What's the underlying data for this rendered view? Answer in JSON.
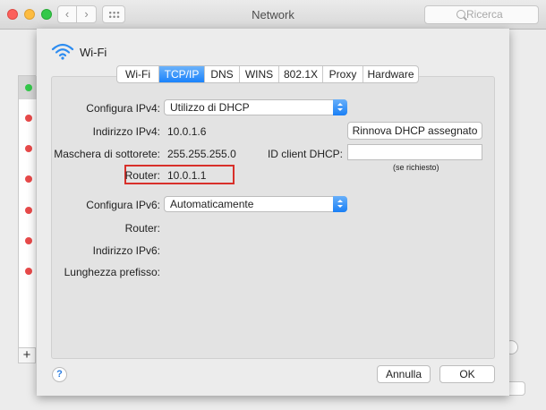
{
  "window": {
    "title": "Network"
  },
  "toolbar": {
    "search_placeholder": "Ricerca",
    "back_icon": "chevron-left-icon",
    "forward_icon": "chevron-right-icon",
    "grid_icon": "grid-icon"
  },
  "sidebar_status_colors": [
    "#34c84a",
    "#e84a4a",
    "#e84a4a",
    "#e84a4a",
    "#e84a4a",
    "#e84a4a",
    "#e84a4a"
  ],
  "sidebar_add_label": "+",
  "sheet": {
    "title": "Wi-Fi",
    "icon": "wifi-icon",
    "tabs": [
      {
        "label": "Wi-Fi",
        "active": false
      },
      {
        "label": "TCP/IP",
        "active": true
      },
      {
        "label": "DNS",
        "active": false
      },
      {
        "label": "WINS",
        "active": false
      },
      {
        "label": "802.1X",
        "active": false
      },
      {
        "label": "Proxy",
        "active": false
      },
      {
        "label": "Hardware",
        "active": false
      }
    ],
    "ipv4": {
      "configure_label": "Configura IPv4:",
      "configure_value": "Utilizzo di DHCP",
      "address_label": "Indirizzo IPv4:",
      "address_value": "10.0.1.6",
      "subnet_label": "Maschera di sottorete:",
      "subnet_value": "255.255.255.0",
      "router_label": "Router:",
      "router_value": "10.0.1.1",
      "renew_button": "Rinnova DHCP assegnato",
      "dhcp_client_label": "ID client DHCP:",
      "dhcp_client_value": "",
      "dhcp_client_hint": "(se richiesto)"
    },
    "ipv6": {
      "configure_label": "Configura IPv6:",
      "configure_value": "Automaticamente",
      "router_label": "Router:",
      "address_label": "Indirizzo IPv6:",
      "prefix_label": "Lunghezza prefisso:"
    },
    "help_label": "?",
    "cancel_button": "Annulla",
    "ok_button": "OK"
  }
}
